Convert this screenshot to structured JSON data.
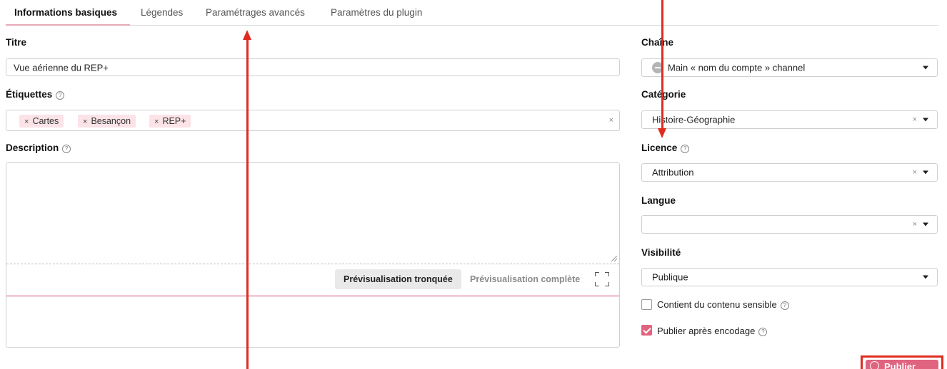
{
  "tabs": [
    {
      "label": "Informations basiques",
      "active": true
    },
    {
      "label": "Légendes",
      "active": false
    },
    {
      "label": "Paramétrages avancés",
      "active": false
    },
    {
      "label": "Paramètres du plugin",
      "active": false
    }
  ],
  "form": {
    "title_label": "Titre",
    "title_value": "Vue aérienne du REP+",
    "tags_label": "Étiquettes",
    "tags": [
      "Cartes",
      "Besançon",
      "REP+"
    ],
    "tag_remove_glyph": "×",
    "description_label": "Description",
    "preview_truncated": "Prévisualisation tronquée",
    "preview_full": "Prévisualisation complète"
  },
  "sidebar": {
    "channel_label": "Chaîne",
    "channel_value": "Main « nom du compte » channel",
    "category_label": "Catégorie",
    "category_value": "Histoire-Géographie",
    "licence_label": "Licence",
    "licence_value": "Attribution",
    "language_label": "Langue",
    "language_value": "",
    "visibility_label": "Visibilité",
    "visibility_value": "Publique",
    "sensitive_label": "Contient du contenu sensible",
    "sensitive_checked": false,
    "publish_after_label": "Publier après encodage",
    "publish_after_checked": true
  },
  "actions": {
    "publish_label": "Publier"
  },
  "icons": {
    "help": "?",
    "clear": "×"
  },
  "colors": {
    "accent": "#e0637f",
    "annotation": "#e02b20"
  }
}
